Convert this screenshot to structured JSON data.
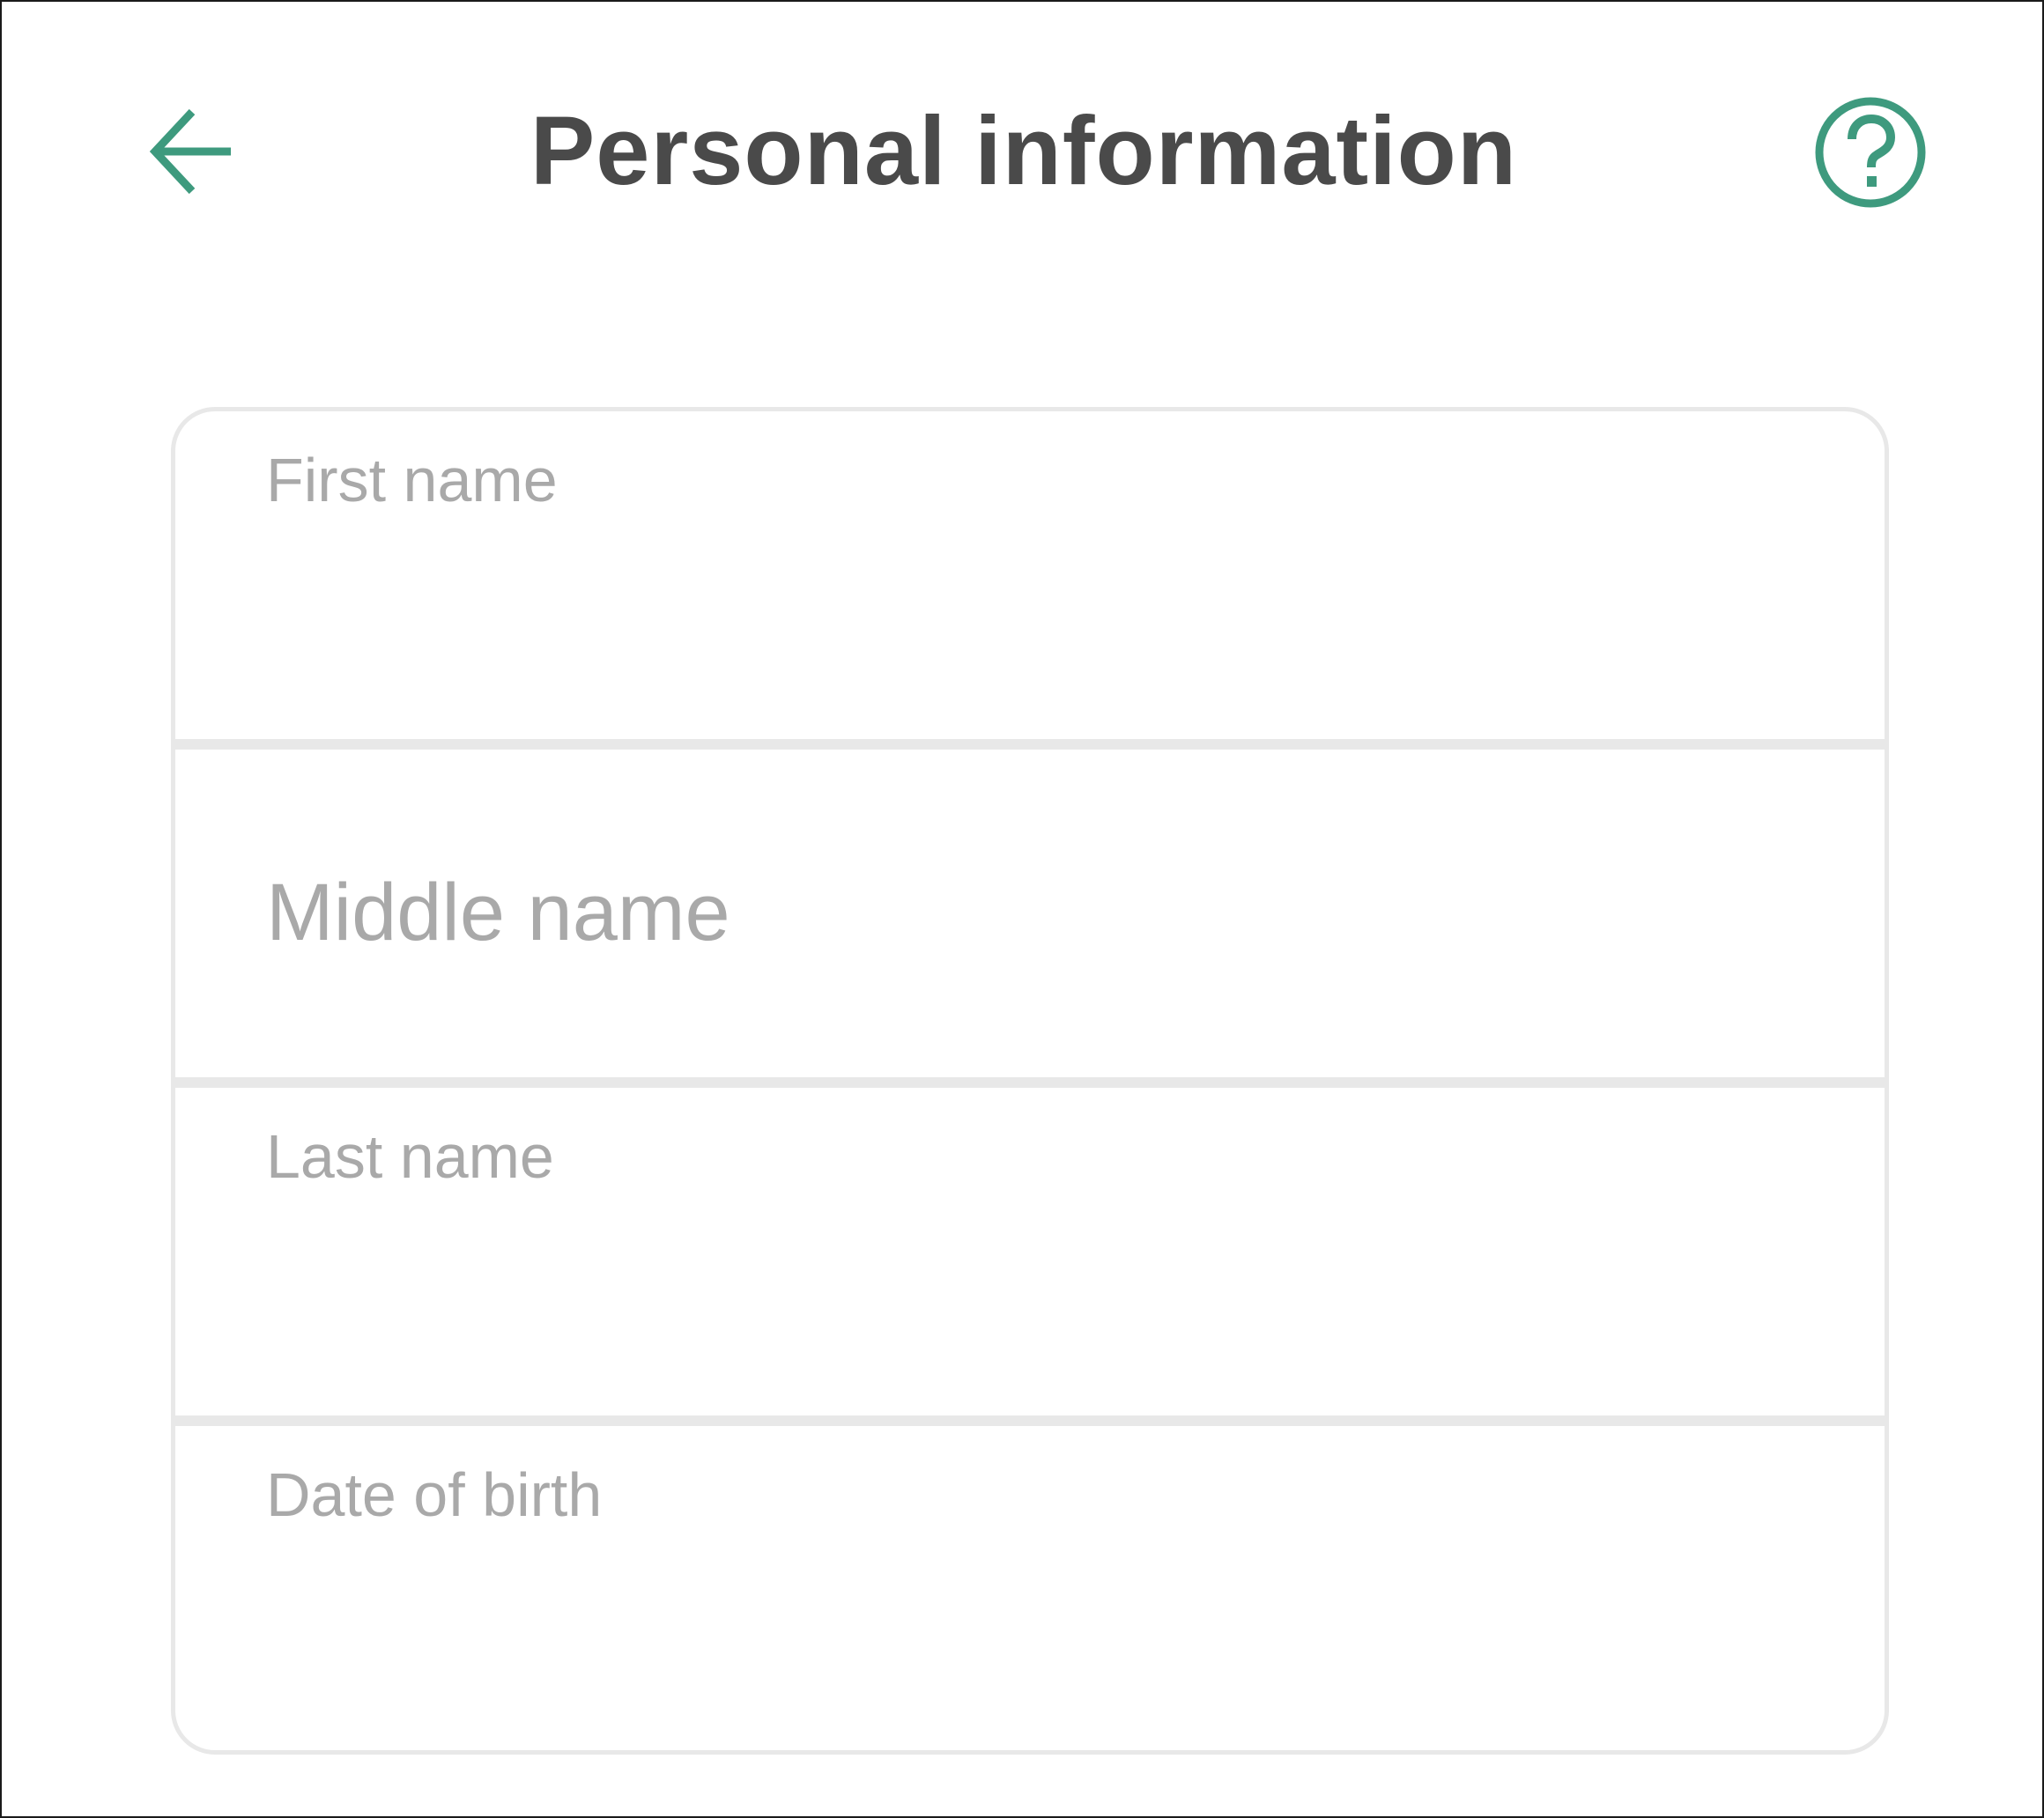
{
  "colors": {
    "accent": "#3e9a7e",
    "title_text": "#4a4a4a",
    "label_text": "#a9a9a9",
    "border": "#e8e8e8"
  },
  "header": {
    "back_icon": "arrow-left-icon",
    "title": "Personal information",
    "help_icon": "question-circle-icon"
  },
  "form": {
    "fields": [
      {
        "label": "First name",
        "value": "",
        "state": "empty-floating-label"
      },
      {
        "label": "Middle name",
        "value": "",
        "state": "placeholder"
      },
      {
        "label": "Last name",
        "value": "",
        "state": "empty-floating-label"
      },
      {
        "label": "Date of birth",
        "value": "",
        "state": "empty-floating-label"
      }
    ]
  }
}
